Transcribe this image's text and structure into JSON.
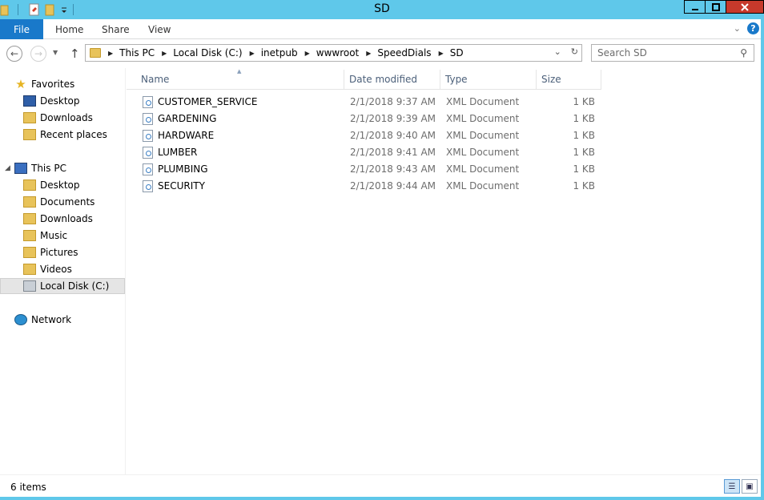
{
  "window": {
    "title": "SD"
  },
  "ribbon": {
    "tabs": [
      {
        "label": "File"
      },
      {
        "label": "Home"
      },
      {
        "label": "Share"
      },
      {
        "label": "View"
      }
    ],
    "help_label": "?"
  },
  "address": {
    "breadcrumbs": [
      "This PC",
      "Local Disk (C:)",
      "inetpub",
      "wwwroot",
      "SpeedDials",
      "SD"
    ]
  },
  "search": {
    "placeholder": "Search SD"
  },
  "navpane": {
    "favorites": {
      "label": "Favorites",
      "items": [
        "Desktop",
        "Downloads",
        "Recent places"
      ]
    },
    "thispc": {
      "label": "This PC",
      "items": [
        "Desktop",
        "Documents",
        "Downloads",
        "Music",
        "Pictures",
        "Videos",
        "Local Disk (C:)"
      ]
    },
    "network": {
      "label": "Network"
    }
  },
  "filelist": {
    "columns": [
      "Name",
      "Date modified",
      "Type",
      "Size"
    ],
    "rows": [
      {
        "name": "CUSTOMER_SERVICE",
        "date": "2/1/2018 9:37 AM",
        "type": "XML Document",
        "size": "1 KB"
      },
      {
        "name": "GARDENING",
        "date": "2/1/2018 9:39 AM",
        "type": "XML Document",
        "size": "1 KB"
      },
      {
        "name": "HARDWARE",
        "date": "2/1/2018 9:40 AM",
        "type": "XML Document",
        "size": "1 KB"
      },
      {
        "name": "LUMBER",
        "date": "2/1/2018 9:41 AM",
        "type": "XML Document",
        "size": "1 KB"
      },
      {
        "name": "PLUMBING",
        "date": "2/1/2018 9:43 AM",
        "type": "XML Document",
        "size": "1 KB"
      },
      {
        "name": "SECURITY",
        "date": "2/1/2018 9:44 AM",
        "type": "XML Document",
        "size": "1 KB"
      }
    ]
  },
  "status": {
    "item_count": "6 items"
  },
  "colors": {
    "titlebar": "#5fc8ea",
    "file_tab": "#1979ca",
    "close": "#c7392b"
  }
}
